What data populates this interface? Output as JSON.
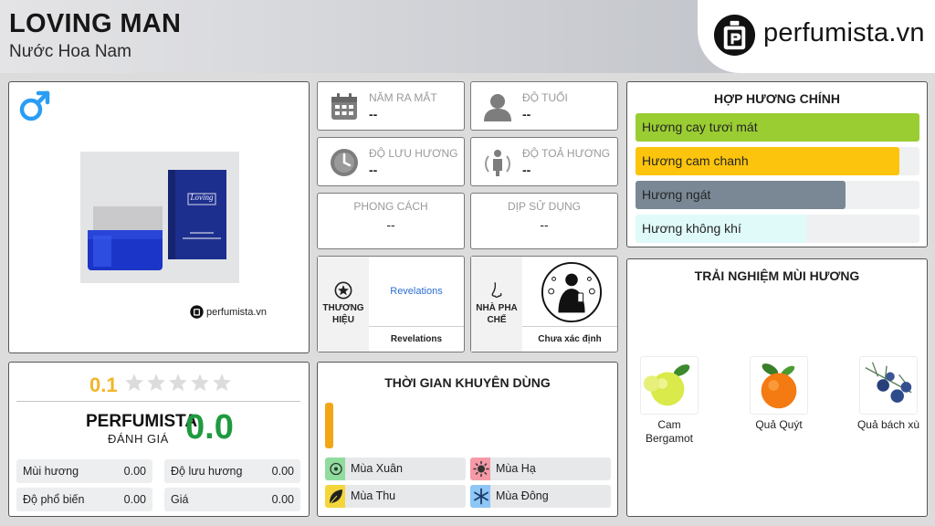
{
  "header": {
    "title": "LOVING MAN",
    "subtitle": "Nước Hoa Nam",
    "logo_text": "perfumista.vn"
  },
  "product": {
    "gender_icon": "male-symbol-icon",
    "watermark": "perfumista.vn",
    "box_label": "Loving"
  },
  "rating": {
    "score": "0.1",
    "stars_filled": 0,
    "stars_total": 5,
    "perfumista_label": "PERFUMISTA",
    "perfumista_sub": "ĐÁNH GIÁ",
    "perfumista_score": "0.0",
    "metrics": [
      {
        "label": "Mùi hương",
        "value": "0.00"
      },
      {
        "label": "Độ lưu hương",
        "value": "0.00"
      },
      {
        "label": "Độ phổ biến",
        "value": "0.00"
      },
      {
        "label": "Giá",
        "value": "0.00"
      }
    ]
  },
  "info": {
    "launch_label": "NĂM RA MẮT",
    "launch_value": "--",
    "age_label": "ĐỘ TUỔI",
    "age_value": "--",
    "longevity_label": "ĐỘ LƯU HƯƠNG",
    "longevity_value": "--",
    "sillage_label": "ĐỘ TOẢ HƯƠNG",
    "sillage_value": "--",
    "style_label": "PHONG CÁCH",
    "style_value": "--",
    "occasion_label": "DỊP SỬ DỤNG",
    "occasion_value": "--",
    "brand_label": "THƯƠNG HIỆU",
    "brand_link": "Revelations",
    "brand_name": "Revelations",
    "perfumer_label": "NHÀ PHA CHẾ",
    "perfumer_name": "Chưa xác định"
  },
  "accords": {
    "title": "HỢP HƯƠNG CHÍNH",
    "items": [
      {
        "label": "Hương cay tươi mát",
        "level": 1.0,
        "color": "#9acd32"
      },
      {
        "label": "Hương cam chanh",
        "level": 0.93,
        "color": "#fcc40c"
      },
      {
        "label": "Hương ngát",
        "level": 0.74,
        "color": "#7a8895"
      },
      {
        "label": "Hương không khí",
        "level": 0.6,
        "color": "#e0fafa"
      }
    ]
  },
  "seasons": {
    "title": "THỜI GIAN KHUYÊN DÙNG",
    "items": [
      {
        "label": "Mùa Xuân",
        "color": "#8fdc9d",
        "icon": "flower-icon"
      },
      {
        "label": "Mùa Hạ",
        "color": "#f59aa6",
        "icon": "sun-icon"
      },
      {
        "label": "Mùa Thu",
        "color": "#f4d63a",
        "icon": "leaf-icon"
      },
      {
        "label": "Mùa Đông",
        "color": "#8ec6f5",
        "icon": "snowflake-icon"
      }
    ]
  },
  "notes": {
    "title": "TRẢI NGHIỆM MÙI HƯƠNG",
    "items": [
      {
        "name": "Cam Bergamot",
        "icon": "bergamot-icon"
      },
      {
        "name": "Quả Quýt",
        "icon": "mandarin-icon"
      },
      {
        "name": "Quả bách xù",
        "icon": "juniper-icon"
      }
    ]
  }
}
